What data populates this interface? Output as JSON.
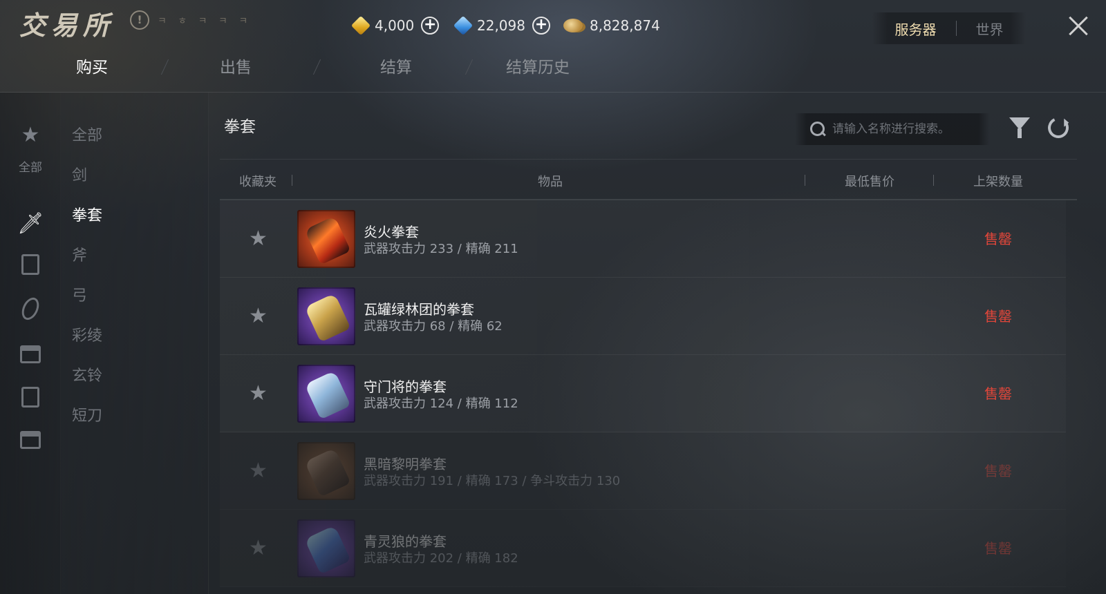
{
  "header": {
    "logo": "交易所",
    "info_icon": "!",
    "logo_sub": "ㅋ ㅎ ㅋ ㅋ ㅋ",
    "currencies": [
      {
        "icon": "gold-gem-icon",
        "value": "4,000",
        "plus": "+"
      },
      {
        "icon": "blue-gem-icon",
        "value": "22,098",
        "plus": "+"
      },
      {
        "icon": "coin-icon",
        "value": "8,828,874"
      }
    ],
    "server_toggle": {
      "active": "服务器",
      "inactive": "世界"
    }
  },
  "tabs": [
    {
      "label": "购买",
      "active": true
    },
    {
      "label": "出售",
      "active": false
    },
    {
      "label": "结算",
      "active": false
    },
    {
      "label": "结算历史",
      "active": false
    }
  ],
  "icon_rail": {
    "items": [
      {
        "icon": "star-icon",
        "label": "全部"
      },
      {
        "icon": "sword-icon",
        "active": true
      },
      {
        "icon": "armor-icon"
      },
      {
        "icon": "ring-icon"
      },
      {
        "icon": "chest-icon"
      },
      {
        "icon": "book-icon"
      },
      {
        "icon": "box-icon"
      }
    ]
  },
  "categories": [
    {
      "label": "全部",
      "active": false
    },
    {
      "label": "剑",
      "active": false
    },
    {
      "label": "拳套",
      "active": true
    },
    {
      "label": "斧",
      "active": false
    },
    {
      "label": "弓",
      "active": false
    },
    {
      "label": "彩绫",
      "active": false
    },
    {
      "label": "玄铃",
      "active": false
    },
    {
      "label": "短刀",
      "active": false
    }
  ],
  "main": {
    "section_title": "拳套",
    "search_placeholder": "请输入名称进行搜索。",
    "columns": [
      "收藏夹",
      "物品",
      "最低售价",
      "上架数量"
    ],
    "star_glyph": "★",
    "rows": [
      {
        "name": "炎火拳套",
        "stats": "武器攻击力 233 / 精确 211",
        "status": "售罄",
        "thumb": "orange",
        "gauntlet": "fire",
        "dim": false
      },
      {
        "name": "瓦罐绿林团的拳套",
        "stats": "武器攻击力 68 / 精确 62",
        "status": "售罄",
        "thumb": "purple",
        "gauntlet": "gold",
        "dim": false
      },
      {
        "name": "守门将的拳套",
        "stats": "武器攻击力 124 / 精确 112",
        "status": "售罄",
        "thumb": "purple",
        "gauntlet": "steel",
        "dim": false
      },
      {
        "name": "黑暗黎明拳套",
        "stats": "武器攻击力 191 / 精确 173 / 争斗攻击力 130",
        "status": "售罄",
        "thumb": "brown",
        "gauntlet": "dark",
        "dim": true
      },
      {
        "name": "青灵狼的拳套",
        "stats": "武器攻击力 202 / 精确 182",
        "status": "售罄",
        "thumb": "purple",
        "gauntlet": "crystal",
        "dim": true
      }
    ]
  },
  "colors": {
    "sold_out": "#e0463a",
    "active_server": "#f0ddb0"
  }
}
